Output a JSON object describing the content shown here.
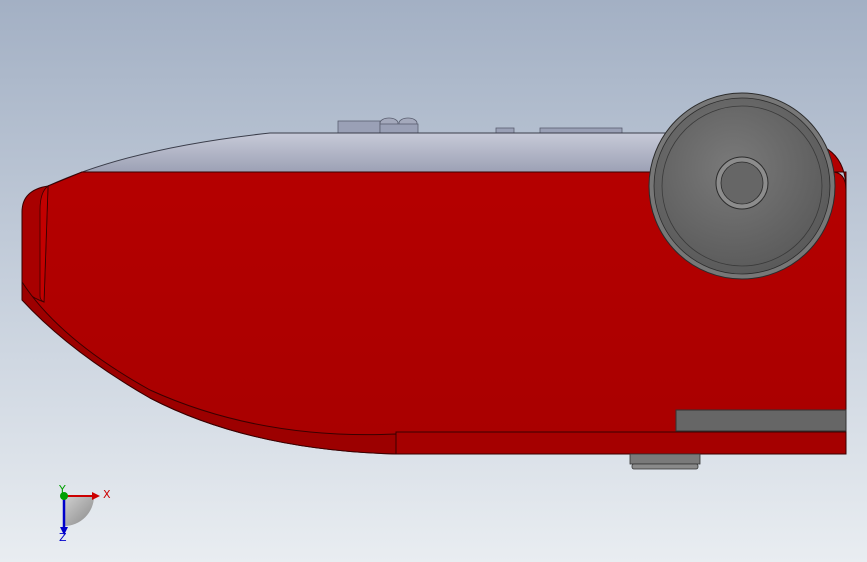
{
  "scene": {
    "background_top": "#a3b0c4",
    "background_bottom": "#e9edf1",
    "body_color": "#b30000",
    "body_shadow_color": "#8c0000",
    "shell_color": "#9a9fb4",
    "wheel_color": "#6f6f6f",
    "panel_color": "#666666"
  },
  "triad": {
    "x_label": "X",
    "y_label": "Y",
    "z_label": "Z",
    "x_color": "#cc0000",
    "y_color": "#00a000",
    "z_color": "#0000cc"
  }
}
